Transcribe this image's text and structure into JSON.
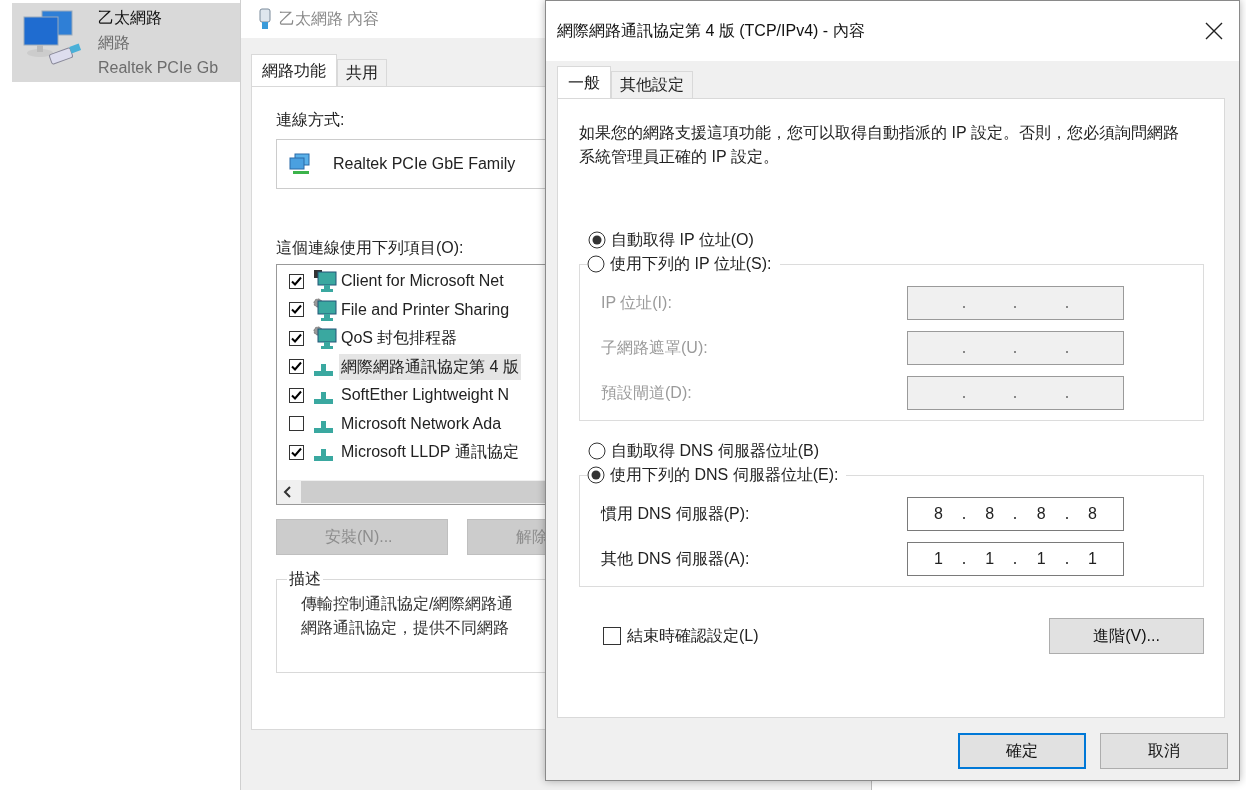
{
  "explorer_item": {
    "name": "乙太網路",
    "type": "網路",
    "adapter": "Realtek PCIe Gb",
    "selected": true
  },
  "properties_window": {
    "title": "乙太網路 內容",
    "tabs": [
      {
        "label": "網路功能",
        "selected": true
      },
      {
        "label": "共用",
        "selected": false
      }
    ],
    "connect_using_label": "連線方式:",
    "adapter": "Realtek PCIe GbE Family",
    "items_label": "這個連線使用下列項目(O):",
    "items": [
      {
        "label": "Client for Microsoft Net",
        "checked": true,
        "selected": false,
        "kind": "client"
      },
      {
        "label": "File and Printer Sharing",
        "checked": true,
        "selected": false,
        "kind": "service"
      },
      {
        "label": "QoS 封包排程器",
        "checked": true,
        "selected": false,
        "kind": "service"
      },
      {
        "label": "網際網路通訊協定第 4 版",
        "checked": true,
        "selected": true,
        "kind": "protocol"
      },
      {
        "label": "SoftEther Lightweight N",
        "checked": true,
        "selected": false,
        "kind": "protocol"
      },
      {
        "label": "Microsoft Network Ada",
        "checked": false,
        "selected": false,
        "kind": "protocol"
      },
      {
        "label": "Microsoft LLDP 通訊協定",
        "checked": true,
        "selected": false,
        "kind": "protocol"
      }
    ],
    "buttons": [
      {
        "label": "安裝(N)...",
        "disabled": true
      },
      {
        "label": "解除",
        "disabled": true
      }
    ],
    "description": {
      "title": "描述",
      "lines": [
        "傳輸控制通訊協定/網際網路通",
        "網路通訊協定，提供不同網路"
      ]
    }
  },
  "ipv4_dialog": {
    "title": "網際網路通訊協定第 4 版 (TCP/IPv4) - 內容",
    "tabs": [
      {
        "label": "一般",
        "selected": true
      },
      {
        "label": "其他設定",
        "selected": false
      }
    ],
    "intro": "如果您的網路支援這項功能，您可以取得自動指派的 IP 設定。否則，您必須詢問網路系統管理員正確的 IP 設定。",
    "ip_section": {
      "options": [
        {
          "label": "自動取得 IP 位址(O)",
          "selected": true
        },
        {
          "label": "使用下列的 IP 位址(S):",
          "selected": false
        }
      ],
      "fields": [
        {
          "label": "IP 位址(I):",
          "disabled": true
        },
        {
          "label": "子網路遮罩(U):",
          "disabled": true
        },
        {
          "label": "預設閘道(D):",
          "disabled": true
        }
      ]
    },
    "dns_section": {
      "options": [
        {
          "label": "自動取得 DNS 伺服器位址(B)",
          "selected": false
        },
        {
          "label": "使用下列的 DNS 伺服器位址(E):",
          "selected": true
        }
      ],
      "fields": [
        {
          "label": "慣用 DNS 伺服器(P):",
          "disabled": false,
          "octets": [
            "8",
            "8",
            "8",
            "8"
          ]
        },
        {
          "label": "其他 DNS 伺服器(A):",
          "disabled": false,
          "octets": [
            "1",
            "1",
            "1",
            "1"
          ]
        }
      ]
    },
    "confirm_on_exit": {
      "label": "結束時確認設定(L)",
      "checked": false
    },
    "advanced_button": "進階(V)...",
    "buttons": [
      {
        "label": "確定",
        "default": true
      },
      {
        "label": "取消",
        "default": false
      }
    ]
  }
}
